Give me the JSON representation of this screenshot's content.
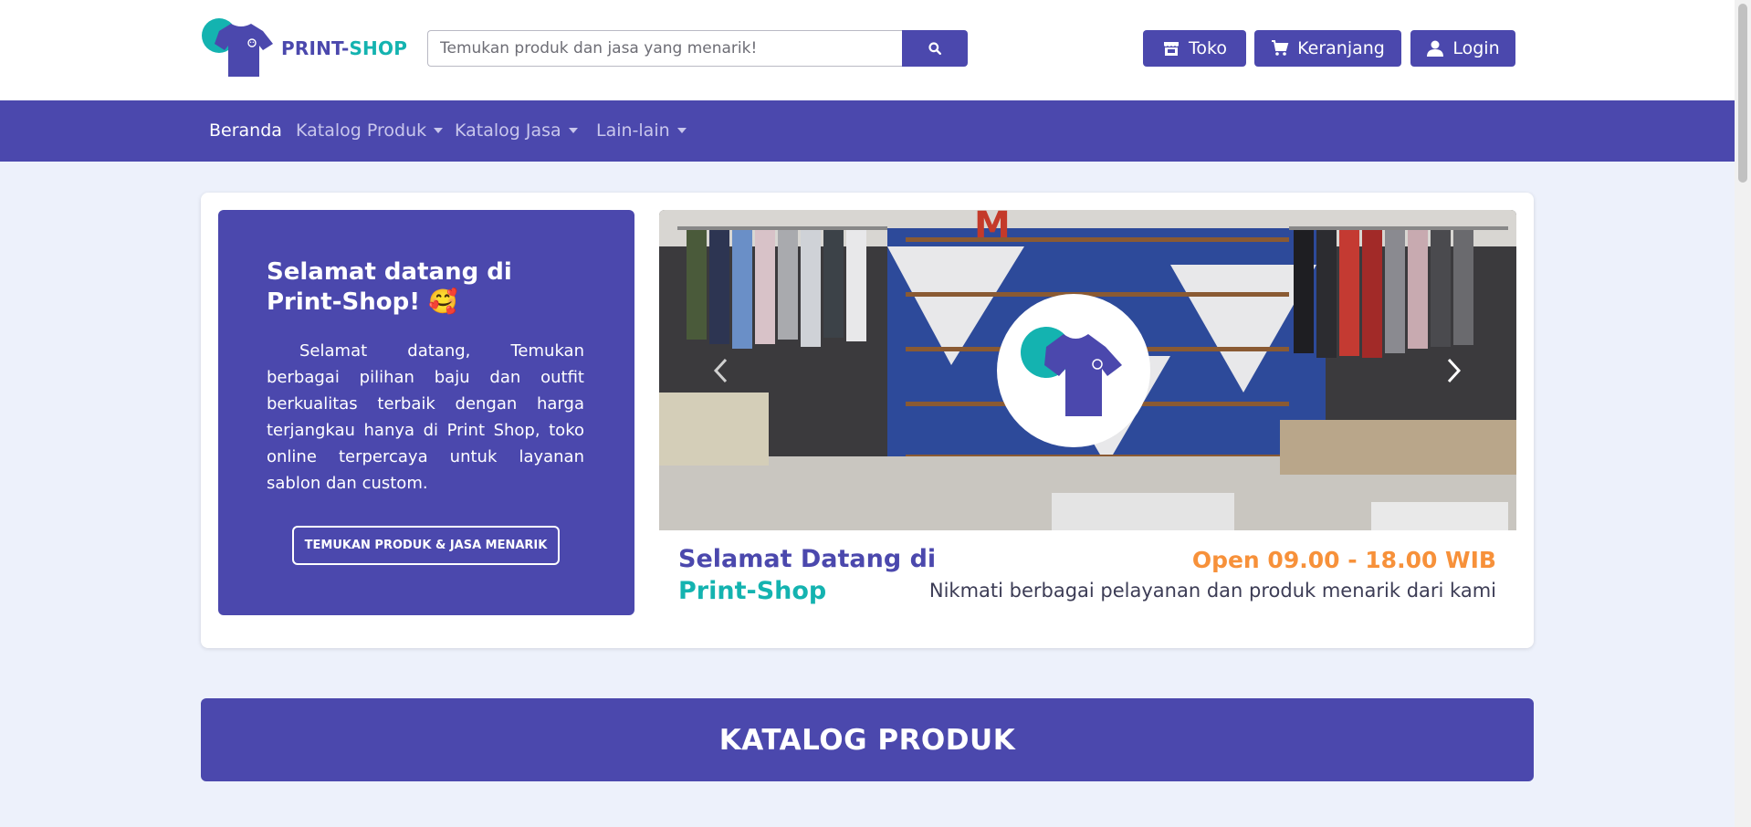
{
  "header": {
    "logo": {
      "text_part1": "PRINT-",
      "text_part2": "SHOP"
    },
    "search": {
      "placeholder": "Temukan produk dan jasa yang menarik!",
      "value": ""
    },
    "buttons": {
      "store": "Toko",
      "cart": "Keranjang",
      "login": "Login"
    }
  },
  "nav": {
    "items": [
      {
        "label": "Beranda"
      },
      {
        "label": "Katalog Produk"
      },
      {
        "label": "Katalog Jasa"
      },
      {
        "label": "Lain-lain"
      }
    ]
  },
  "hero": {
    "welcome_title": "Selamat datang di Print-Shop! 🥰",
    "welcome_text": "Selamat datang, Temukan berbagai pilihan baju dan outfit berkualitas terbaik dengan harga terjangkau hanya di Print Shop, toko online terpercaya untuk layanan sablon dan custom.",
    "cta_label": "TEMUKAN PRODUK & JASA MENARIK",
    "caption_line1": "Selamat Datang di",
    "caption_line2": "Print-Shop",
    "hours": "Open 09.00 - 18.00 WIB",
    "tagline": "Nikmati berbagai pelayanan dan produk menarik dari kami"
  },
  "section": {
    "title": "KATALOG PRODUK"
  },
  "colors": {
    "brand": "#4b48ad",
    "teal": "#14b3b0",
    "orange": "#f7913a",
    "background": "#edf1fb"
  },
  "icons": [
    "search-icon",
    "store-icon",
    "cart-icon",
    "user-icon",
    "chevron-left-icon",
    "chevron-right-icon",
    "tshirt-logo-icon"
  ]
}
